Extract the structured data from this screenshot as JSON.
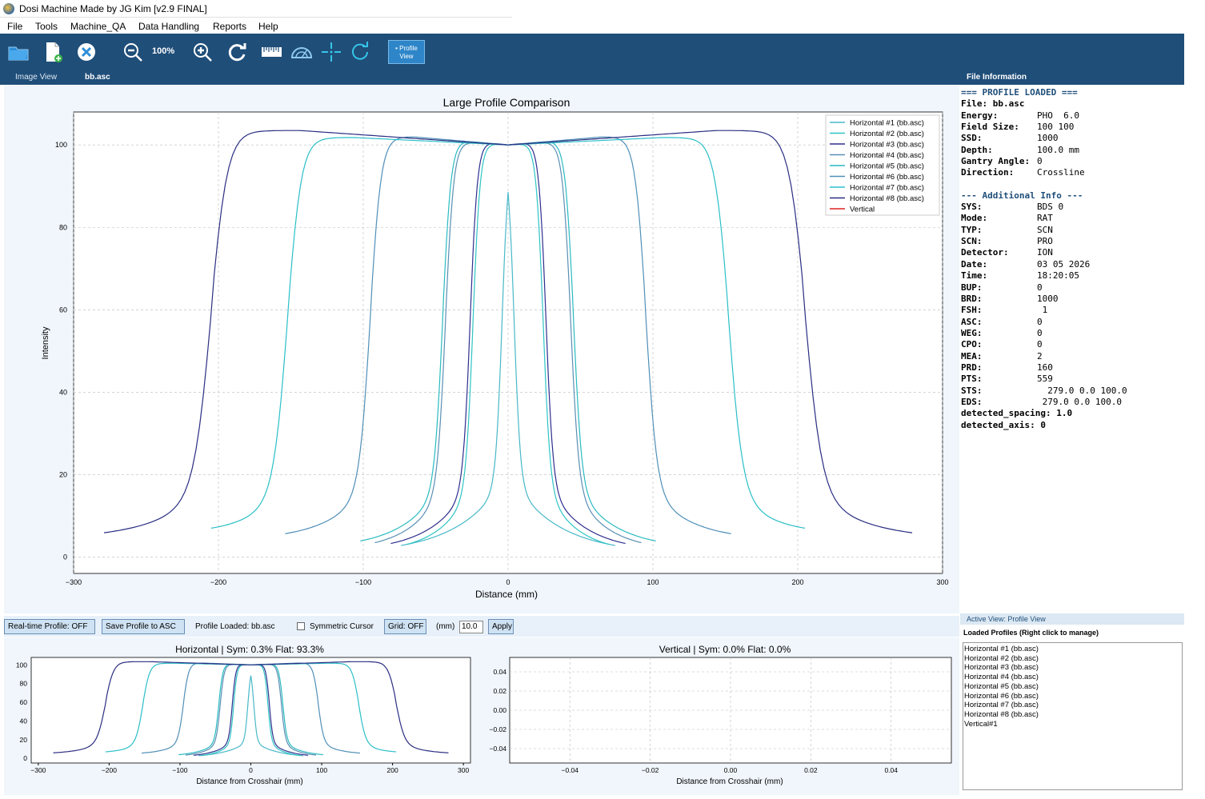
{
  "window": {
    "title": "Dosi Machine Made by JG Kim    [v2.9 FINAL]"
  },
  "menu": [
    "File",
    "Tools",
    "Machine_QA",
    "Data Handling",
    "Reports",
    "Help"
  ],
  "toolbar": {
    "zoom_label": "100%",
    "profile_view_label": "• Profile View"
  },
  "tabs": {
    "image_view": "Image View",
    "file_tab": "bb.asc"
  },
  "file_info_panel": {
    "title": "File Information",
    "profile_loaded_header": "=== PROFILE LOADED ===",
    "file_row": "File: bb.asc",
    "rows": [
      {
        "key": "Energy:",
        "value": "PHO  6.0"
      },
      {
        "key": "Field Size:",
        "value": "100 100"
      },
      {
        "key": "SSD:",
        "value": "1000"
      },
      {
        "key": "Depth:",
        "value": "100.0 mm"
      },
      {
        "key": "Gantry Angle:",
        "value": "0"
      },
      {
        "key": "Direction:",
        "value": "Crossline"
      }
    ],
    "additional_header": "--- Additional Info ---",
    "additional_rows": [
      {
        "key": "SYS:",
        "value": "BDS 0"
      },
      {
        "key": "Mode:",
        "value": "RAT"
      },
      {
        "key": "TYP:",
        "value": "SCN"
      },
      {
        "key": "SCN:",
        "value": "PRO"
      },
      {
        "key": "Detector:",
        "value": "ION"
      },
      {
        "key": "Date:",
        "value": "03 05 2026"
      },
      {
        "key": "Time:",
        "value": "18:20:05"
      },
      {
        "key": "BUP:",
        "value": "0"
      },
      {
        "key": "BRD:",
        "value": "1000"
      },
      {
        "key": "FSH:",
        "value": " 1"
      },
      {
        "key": "ASC:",
        "value": "0"
      },
      {
        "key": "WEG:",
        "value": "0"
      },
      {
        "key": "CPO:",
        "value": "0"
      },
      {
        "key": "MEA:",
        "value": "2"
      },
      {
        "key": "PRD:",
        "value": "160"
      },
      {
        "key": "PTS:",
        "value": "559"
      },
      {
        "key": "STS:",
        "value": "  279.0 0.0 100.0"
      },
      {
        "key": "EDS:",
        "value": " 279.0 0.0 100.0"
      }
    ],
    "tail_rows": [
      "detected_spacing: 1.0",
      "detected_axis: 0"
    ]
  },
  "controls": {
    "realtime_profile": "Real-time Profile: OFF",
    "save_profile": "Save Profile to ASC",
    "profile_loaded": "Profile Loaded: bb.asc",
    "symmetric_cursor": "Symmetric Cursor",
    "grid": "Grid: OFF",
    "mm_label": "(mm)",
    "mm_value": "10.0",
    "apply": "Apply"
  },
  "right_panel": {
    "active_view": "Active View: Profile View",
    "loaded_profiles_header": "Loaded Profiles (Right click to manage)",
    "loaded_profiles": [
      "Horizontal #1 (bb.asc)",
      "Horizontal #2 (bb.asc)",
      "Horizontal #3 (bb.asc)",
      "Horizontal #4 (bb.asc)",
      "Horizontal #5 (bb.asc)",
      "Horizontal #6 (bb.asc)",
      "Horizontal #7 (bb.asc)",
      "Horizontal #8 (bb.asc)",
      "Vertical#1"
    ]
  },
  "chart_data": [
    {
      "type": "line",
      "title": "Large Profile Comparison",
      "xlabel": "Distance (mm)",
      "ylabel": "Intensity",
      "xlim": [
        -300,
        300
      ],
      "ylim": [
        -4,
        108
      ],
      "xticks": [
        -300,
        -200,
        -100,
        0,
        100,
        200,
        300
      ],
      "xtick_labels": [
        "−300",
        "−200",
        "−100",
        "0",
        "100",
        "200",
        "300"
      ],
      "yticks": [
        0,
        20,
        40,
        60,
        80,
        100
      ],
      "grid": true,
      "legend": "top-right",
      "series": [
        {
          "name": "Horizontal #1 (bb.asc)",
          "color": "#48b8c8",
          "half_width": 4,
          "x_end": 74,
          "y_end": 0.8,
          "top": 100.3
        },
        {
          "name": "Horizontal #2 (bb.asc)",
          "color": "#2ec4c4",
          "half_width": 24,
          "x_end": 70,
          "y_end": 1.0,
          "top": 100.5
        },
        {
          "name": "Horizontal #3 (bb.asc)",
          "color": "#2e2f8e",
          "half_width": 26,
          "x_end": 81,
          "y_end": 1.3,
          "top": 100.8
        },
        {
          "name": "Horizontal #4 (bb.asc)",
          "color": "#5a8fb4",
          "half_width": 43,
          "x_end": 92,
          "y_end": 1.5,
          "top": 100.7
        },
        {
          "name": "Horizontal #5 (bb.asc)",
          "color": "#2abac0",
          "half_width": 45,
          "x_end": 102,
          "y_end": 2.0,
          "top": 101.0
        },
        {
          "name": "Horizontal #6 (bb.asc)",
          "color": "#4f8fb8",
          "half_width": 95,
          "x_end": 154,
          "y_end": 4.0,
          "top": 102.0
        },
        {
          "name": "Horizontal #7 (bb.asc)",
          "color": "#2abfc8",
          "half_width": 152,
          "x_end": 205,
          "y_end": 5.5,
          "top": 101.8
        },
        {
          "name": "Horizontal #8 (bb.asc)",
          "color": "#2b2d82",
          "half_width": 205,
          "x_end": 279,
          "y_end": 4.3,
          "top": 103.5
        },
        {
          "name": "Vertical",
          "color": "#e02020",
          "values": []
        }
      ]
    },
    {
      "type": "line",
      "title": "Horizontal | Sym: 0.3% Flat: 93.3%",
      "xlabel": "Distance from Crosshair (mm)",
      "ylabel": "",
      "xlim": [
        -310,
        310
      ],
      "ylim": [
        -5,
        108
      ],
      "xticks": [
        -300,
        -200,
        -100,
        0,
        100,
        200,
        300
      ],
      "xtick_labels": [
        "−300",
        "−200",
        "−100",
        "0",
        "100",
        "200",
        "300"
      ],
      "yticks": [
        0,
        20,
        40,
        60,
        80,
        100
      ]
    },
    {
      "type": "line",
      "title": "Vertical | Sym: 0.0% Flat: 0.0%",
      "xlabel": "Distance from Crosshair (mm)",
      "ylabel": "",
      "xlim": [
        -0.055,
        0.055
      ],
      "ylim": [
        -0.055,
        0.055
      ],
      "xticks": [
        -0.04,
        -0.02,
        0.0,
        0.02,
        0.04
      ],
      "xtick_labels": [
        "−0.04",
        "−0.02",
        "0.00",
        "0.02",
        "0.04"
      ],
      "yticks": [
        -0.04,
        -0.02,
        0.0,
        0.02,
        0.04
      ],
      "ytick_labels": [
        "−0.04",
        "−0.02",
        "0.00",
        "0.02",
        "0.04"
      ],
      "series": []
    }
  ]
}
